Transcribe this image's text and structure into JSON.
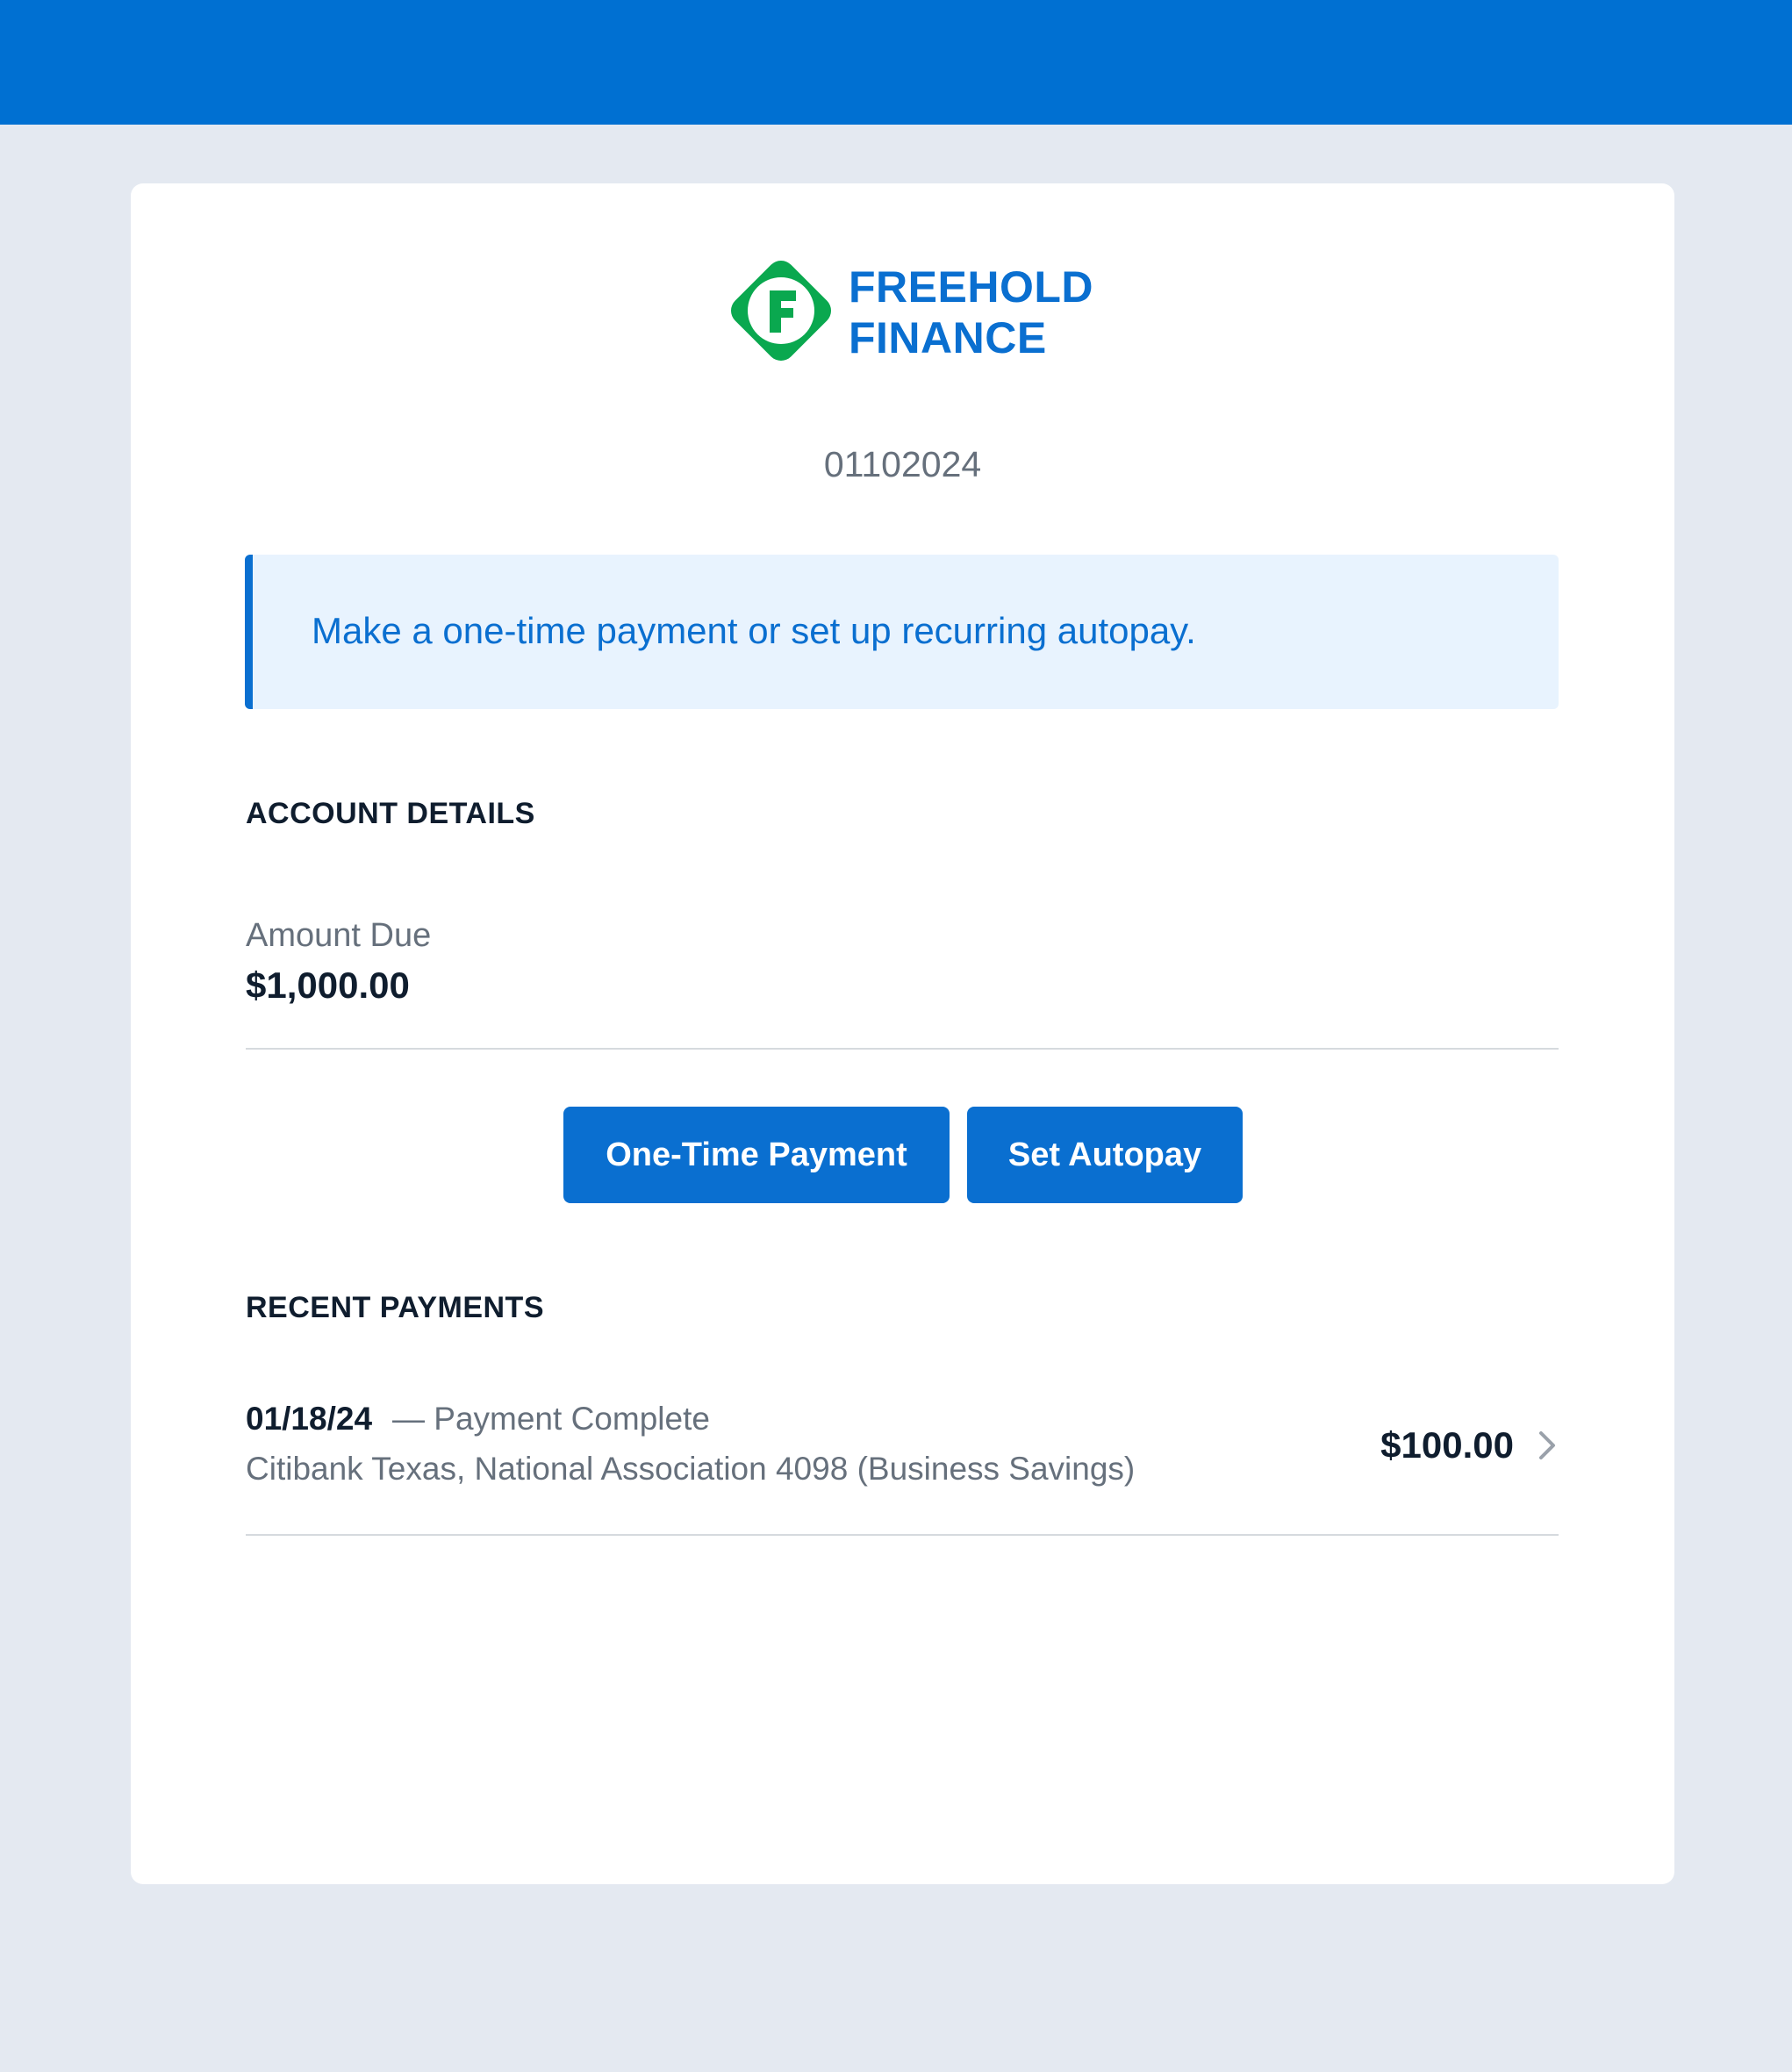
{
  "header": {
    "bar_color": "#0070d2"
  },
  "brand": {
    "line1": "FREEHOLD",
    "line2": "FINANCE",
    "icon_letter": "F",
    "icon_color": "#0aa84f",
    "text_color": "#0a6fd0"
  },
  "account": {
    "number": "01102024"
  },
  "banner": {
    "text": "Make a one-time payment or set up recurring autopay."
  },
  "account_details": {
    "heading": "ACCOUNT DETAILS",
    "amount_due_label": "Amount Due",
    "amount_due_value": "$1,000.00"
  },
  "actions": {
    "one_time_label": "One-Time Payment",
    "autopay_label": "Set Autopay"
  },
  "recent_payments": {
    "heading": "RECENT PAYMENTS",
    "items": [
      {
        "date": "01/18/24",
        "status": "— Payment Complete",
        "bank": "Citibank Texas, National Association 4098 (Business Savings)",
        "amount": "$100.00",
        "icon": "chevron-right-icon"
      }
    ]
  }
}
